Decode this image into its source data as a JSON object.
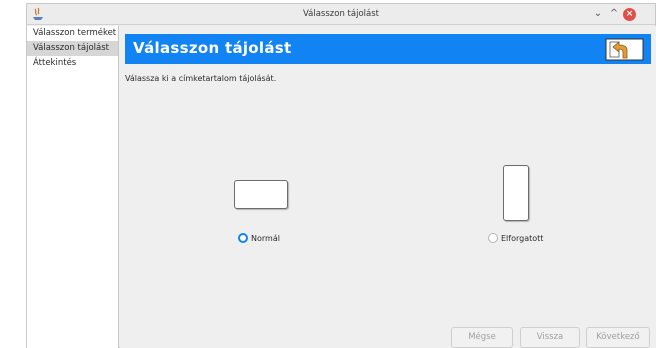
{
  "window": {
    "title": "Válasszon tájolást"
  },
  "sidebar": {
    "items": [
      {
        "label": "Válasszon terméket"
      },
      {
        "label": "Válasszon tájolást"
      },
      {
        "label": "Áttekintés"
      }
    ]
  },
  "banner": {
    "title": "Válasszon tájolást",
    "icon": "back-arrow-icon"
  },
  "description": "Válassza ki a címketartalom tájolását.",
  "orientation": {
    "options": [
      {
        "label": "Normál",
        "selected": true
      },
      {
        "label": "Elforgatott",
        "selected": false
      }
    ]
  },
  "footer": {
    "cancel_label": "Mégse",
    "back_label": "Vissza",
    "next_label": "Következő"
  },
  "colors": {
    "accent": "#1283f2",
    "close": "#e0504a"
  }
}
